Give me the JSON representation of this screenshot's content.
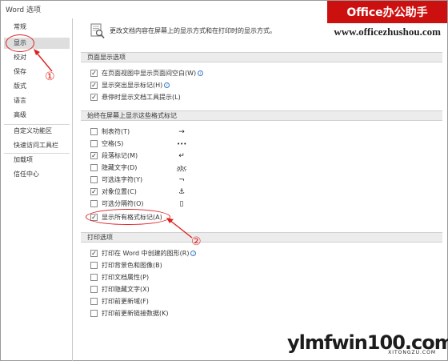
{
  "window": {
    "title": "Word 选项"
  },
  "banner": {
    "brand": "Office办公助手",
    "url": "www.officezhushou.com"
  },
  "sidebar": {
    "items": [
      {
        "label": "常规"
      },
      {
        "label": "显示"
      },
      {
        "label": "校对"
      },
      {
        "label": "保存"
      },
      {
        "label": "版式"
      },
      {
        "label": "语言"
      },
      {
        "label": "高级"
      },
      {
        "label": "自定义功能区"
      },
      {
        "label": "快速访问工具栏"
      },
      {
        "label": "加载项"
      },
      {
        "label": "信任中心"
      }
    ]
  },
  "header": {
    "text": "更改文档内容在屏幕上的显示方式和在打印时的显示方式。"
  },
  "sections": {
    "page_display": {
      "title": "页面显示选项",
      "options": [
        {
          "label": "在页面视图中显示页面间空白(W)",
          "checked": true,
          "info": "i"
        },
        {
          "label": "显示突出显示标记(H)",
          "checked": true,
          "info": "i"
        },
        {
          "label": "悬停时显示文档工具提示(L)",
          "checked": true,
          "info": ""
        }
      ]
    },
    "format_marks": {
      "title": "始终在屏幕上显示这些格式标记",
      "options": [
        {
          "label": "制表符(T)",
          "checked": false,
          "symbol": "→"
        },
        {
          "label": "空格(S)",
          "checked": false,
          "symbol": "•••"
        },
        {
          "label": "段落标记(M)",
          "checked": true,
          "symbol": "↵"
        },
        {
          "label": "隐藏文字(D)",
          "checked": false,
          "symbol": "abc"
        },
        {
          "label": "可选连字符(Y)",
          "checked": false,
          "symbol": "¬"
        },
        {
          "label": "对象位置(C)",
          "checked": true,
          "symbol": "⚓"
        },
        {
          "label": "可选分隔符(O)",
          "checked": false,
          "symbol": "▯"
        },
        {
          "label": "显示所有格式标记(A)",
          "checked": true,
          "symbol": ""
        }
      ]
    },
    "print": {
      "title": "打印选项",
      "options": [
        {
          "label": "打印在 Word 中创建的图形(R)",
          "checked": true,
          "info": "i"
        },
        {
          "label": "打印背景色和图像(B)",
          "checked": false,
          "info": ""
        },
        {
          "label": "打印文档属性(P)",
          "checked": false,
          "info": ""
        },
        {
          "label": "打印隐藏文字(X)",
          "checked": false,
          "info": ""
        },
        {
          "label": "打印前更新域(F)",
          "checked": false,
          "info": ""
        },
        {
          "label": "打印前更新链接数据(K)",
          "checked": false,
          "info": ""
        }
      ]
    }
  },
  "annotations": {
    "marker1": "①",
    "marker2": "②"
  },
  "watermark": {
    "main": "ylmfwin100.com",
    "sub": "XITONGZU.COM"
  },
  "check_glyph": "✓",
  "colors": {
    "annotation": "#e02020",
    "banner": "#cc1010",
    "info": "#3b7bc2"
  }
}
